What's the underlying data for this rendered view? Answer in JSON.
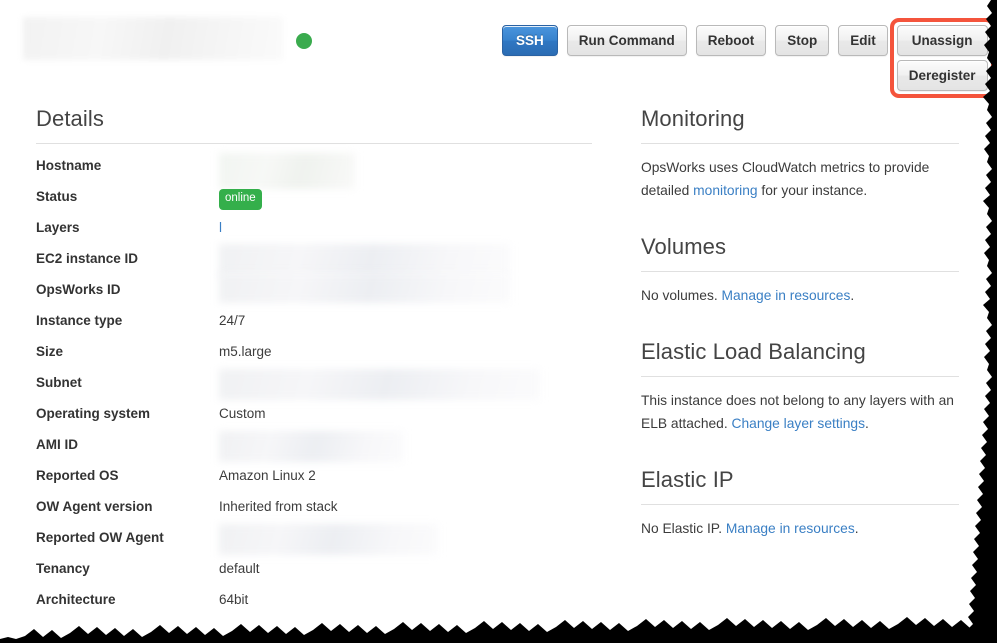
{
  "header": {
    "instance_name": "",
    "status_indicator": "online-green-dot",
    "buttons": [
      {
        "label": "SSH",
        "style": "primary"
      },
      {
        "label": "Run Command",
        "style": "default"
      },
      {
        "label": "Reboot",
        "style": "default"
      },
      {
        "label": "Stop",
        "style": "default"
      },
      {
        "label": "Edit",
        "style": "default"
      },
      {
        "label": "Unassign",
        "style": "default",
        "highlighted": true
      },
      {
        "label": "Deregister",
        "style": "default"
      }
    ],
    "highlight_color": "#f4543c"
  },
  "details": {
    "title": "Details",
    "rows": [
      {
        "label": "Hostname",
        "value": "",
        "kind": "redacted"
      },
      {
        "label": "Status",
        "value": "online",
        "kind": "badge"
      },
      {
        "label": "Layers",
        "value": "l",
        "kind": "link"
      },
      {
        "label": "EC2 instance ID",
        "value": "",
        "kind": "redacted"
      },
      {
        "label": "OpsWorks ID",
        "value": "",
        "kind": "redacted"
      },
      {
        "label": "Instance type",
        "value": "24/7",
        "kind": "text"
      },
      {
        "label": "Size",
        "value": "m5.large",
        "kind": "text"
      },
      {
        "label": "Subnet",
        "value": "",
        "kind": "redacted"
      },
      {
        "label": "Operating system",
        "value": "Custom",
        "kind": "text"
      },
      {
        "label": "AMI ID",
        "value": "",
        "kind": "redacted"
      },
      {
        "label": "Reported OS",
        "value": "Amazon Linux 2",
        "kind": "text"
      },
      {
        "label": "OW Agent version",
        "value": "Inherited from stack",
        "kind": "text"
      },
      {
        "label": "Reported OW Agent",
        "value": "",
        "kind": "redacted"
      },
      {
        "label": "Tenancy",
        "value": "default",
        "kind": "text"
      },
      {
        "label": "Architecture",
        "value": "64bit",
        "kind": "text"
      }
    ]
  },
  "monitoring": {
    "title": "Monitoring",
    "text_before": "OpsWorks uses CloudWatch metrics to provide detailed ",
    "link": "monitoring",
    "text_after": " for your instance."
  },
  "volumes": {
    "title": "Volumes",
    "text_before": "No volumes. ",
    "link": "Manage in resources",
    "text_after": "."
  },
  "elb": {
    "title": "Elastic Load Balancing",
    "text_before": "This instance does not belong to any layers with an ELB attached. ",
    "link": "Change layer settings",
    "text_after": "."
  },
  "elastic_ip": {
    "title": "Elastic IP",
    "text_before": "No Elastic IP. ",
    "link": "Manage in resources",
    "text_after": "."
  },
  "theme": {
    "link_color": "#3a7fc4",
    "badge_green": "#34af4b",
    "dot_green": "#3aab4e",
    "primary_blue": "#3782cd",
    "heading_gray": "#444444",
    "rule_gray": "#e0e0e0"
  }
}
